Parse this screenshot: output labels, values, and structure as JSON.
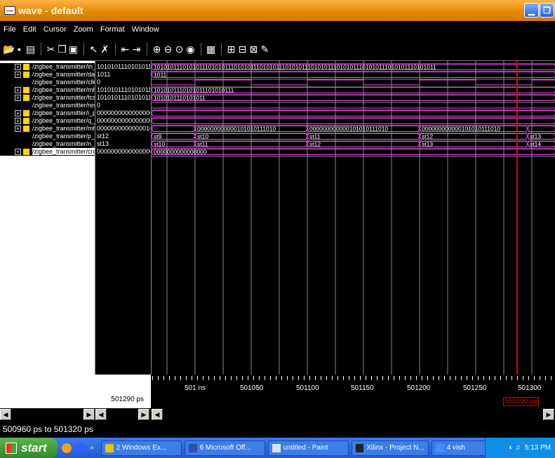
{
  "window": {
    "title": "wave - default"
  },
  "menu": [
    "File",
    "Edit",
    "Cursor",
    "Zoom",
    "Format",
    "Window"
  ],
  "signals": [
    {
      "name": "/zigbee_transmitter/in_",
      "value": "101010111010101110",
      "expandable": true
    },
    {
      "name": "/zigbee_transmitter/dat",
      "value": "1011",
      "expandable": true
    },
    {
      "name": "/zigbee_transmitter/clk",
      "value": "0",
      "expandable": false
    },
    {
      "name": "/zigbee_transmitter/mh",
      "value": "101010111010101110",
      "expandable": true
    },
    {
      "name": "/zigbee_transmitter/fcs",
      "value": "1010101110101011",
      "expandable": true
    },
    {
      "name": "/zigbee_transmitter/res",
      "value": "0",
      "expandable": false
    },
    {
      "name": "/zigbee_transmitter/i_pl",
      "value": "000000000000000000",
      "expandable": true
    },
    {
      "name": "/zigbee_transmitter/q_p",
      "value": "000000000000000000",
      "expandable": true
    },
    {
      "name": "/zigbee_transmitter/mh",
      "value": "000000000000001010",
      "expandable": true
    },
    {
      "name": "/zigbee_transmitter/p_s",
      "value": "st12",
      "expandable": false
    },
    {
      "name": "/zigbee_transmitter/n_s",
      "value": "st13",
      "expandable": false
    },
    {
      "name": "/zigbee_transmitter/crc",
      "value": "000000000000000000",
      "expandable": true,
      "selected": true
    }
  ],
  "waves": {
    "in": "1010101110101011101010111010101110101011101010111010101110101011101010111010101110101011",
    "dat": "1011",
    "mh1": "1010101110101011101010111",
    "fcs": "1010101110101011",
    "mh2_segments": [
      "000000000000101010111010",
      "000000000000101010111010",
      "000000000000101010111010"
    ],
    "p_s": [
      "st9",
      "st10",
      "st11",
      "st12",
      "st13"
    ],
    "n_s": [
      "st10",
      "st11",
      "st12",
      "st13",
      "st14"
    ],
    "crc": "0000000000000000"
  },
  "timeline": {
    "cursor_value": "501290 ps",
    "cursor_label": "501290 ps",
    "ticks": [
      "501 ns",
      "501050",
      "501100",
      "501150",
      "501200",
      "501250",
      "501300"
    ]
  },
  "status": {
    "range": "500960 ps to 501320 ps"
  },
  "taskbar": {
    "start": "start",
    "tasks": [
      "2 Windows Ex...",
      "6 Microsoft Off...",
      "untitled - Paint",
      "Xilinx - Project N...",
      "4 vish"
    ],
    "clock": "5:13 PM"
  }
}
